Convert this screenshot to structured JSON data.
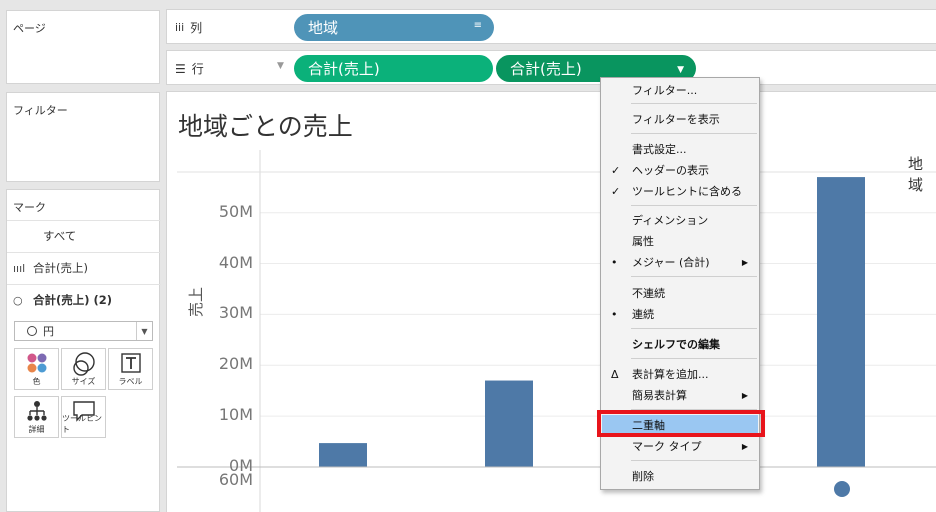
{
  "panels": {
    "pages_title": "ページ",
    "filters_title": "フィルター",
    "marks_title": "マーク"
  },
  "marks": {
    "all": "すべて",
    "measure1": "合計(売上)",
    "measure2": "合計(売上) (2)",
    "mark_type": "円",
    "buttons": {
      "color": "色",
      "size": "サイズ",
      "label": "ラベル",
      "detail": "詳細",
      "tooltip": "ツールヒント"
    }
  },
  "shelves": {
    "columns_label": "列",
    "rows_label": "行",
    "columns_pill": "地域",
    "rows_pill_1": "合計(売上)",
    "rows_pill_2": "合計(売上)"
  },
  "view": {
    "title": "地域ごとの売上",
    "column_header": "地域",
    "y_axis_label": "売上"
  },
  "chart_data": {
    "type": "bar",
    "ylabel": "売上",
    "ylim": [
      0,
      58000000
    ],
    "y_ticks": [
      "0M",
      "10M",
      "20M",
      "30M",
      "40M",
      "50M"
    ],
    "lower_axis_tick": "60M",
    "values": [
      4700000,
      17000000,
      57000000
    ],
    "bar_color": "#4e79a7"
  },
  "context_menu": {
    "items": [
      {
        "label": "フィルター...",
        "check": "",
        "sub": false
      },
      {
        "label": "フィルターを表示",
        "check": "",
        "sub": false
      },
      {
        "label": "書式設定...",
        "check": "",
        "sub": false
      },
      {
        "label": "ヘッダーの表示",
        "check": "✓",
        "sub": false
      },
      {
        "label": "ツールヒントに含める",
        "check": "✓",
        "sub": false
      },
      {
        "label": "ディメンション",
        "check": "",
        "sub": false
      },
      {
        "label": "属性",
        "check": "",
        "sub": false
      },
      {
        "label": "メジャー (合計)",
        "check": "•",
        "sub": true
      },
      {
        "label": "不連続",
        "check": "",
        "sub": false
      },
      {
        "label": "連続",
        "check": "•",
        "sub": false
      },
      {
        "label": "シェルフでの編集",
        "check": "",
        "sub": false
      },
      {
        "label": "表計算を追加...",
        "check": "Δ",
        "sub": false
      },
      {
        "label": "簡易表計算",
        "check": "",
        "sub": true
      },
      {
        "label": "二重軸",
        "check": "",
        "sub": false
      },
      {
        "label": "マーク タイプ",
        "check": "",
        "sub": true
      },
      {
        "label": "削除",
        "check": "",
        "sub": false
      }
    ]
  },
  "colors": {
    "accent_highlight": "#e8141b",
    "pill_blue": "#4f94b8",
    "pill_green": "#0bb17a"
  }
}
